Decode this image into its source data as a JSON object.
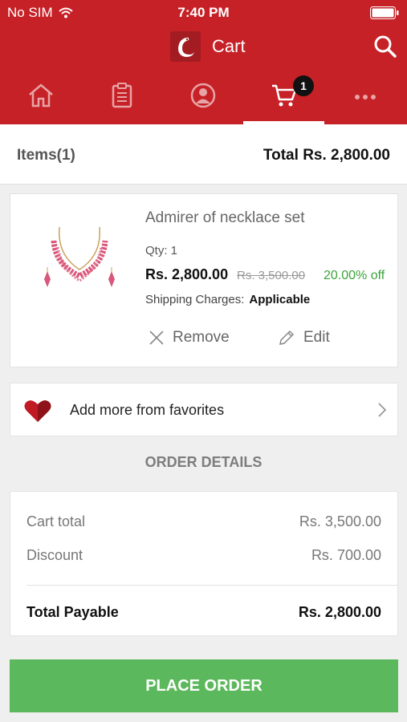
{
  "status_bar": {
    "carrier": "No SIM",
    "time": "7:40 PM"
  },
  "header": {
    "title": "Cart",
    "accent_color": "#c62127"
  },
  "nav": {
    "tabs": [
      {
        "name": "home",
        "icon": "home-icon"
      },
      {
        "name": "orders",
        "icon": "clipboard-icon"
      },
      {
        "name": "profile",
        "icon": "user-icon"
      },
      {
        "name": "cart",
        "icon": "cart-icon",
        "active": true,
        "badge": "1"
      },
      {
        "name": "more",
        "icon": "more-icon"
      }
    ]
  },
  "summary_bar": {
    "items_label": "Items(1)",
    "total_label": "Total",
    "total_value": "Rs. 2,800.00"
  },
  "cart_item": {
    "name": "Admirer of necklace set",
    "qty": "Qty: 1",
    "price": "Rs. 2,800.00",
    "mrp": "Rs. 3,500.00",
    "discount": "20.00% off",
    "shipping_label": "Shipping Charges:",
    "shipping_value": "Applicable",
    "remove_label": "Remove",
    "edit_label": "Edit"
  },
  "favorites": {
    "label": "Add more from favorites"
  },
  "order_details": {
    "heading": "ORDER DETAILS",
    "cart_total_label": "Cart total",
    "cart_total_value": "Rs. 3,500.00",
    "discount_label": "Discount",
    "discount_value": "Rs. 700.00",
    "payable_label": "Total Payable",
    "payable_value": "Rs. 2,800.00"
  },
  "place_order": {
    "label": "PLACE ORDER",
    "color": "#5cb85c"
  }
}
